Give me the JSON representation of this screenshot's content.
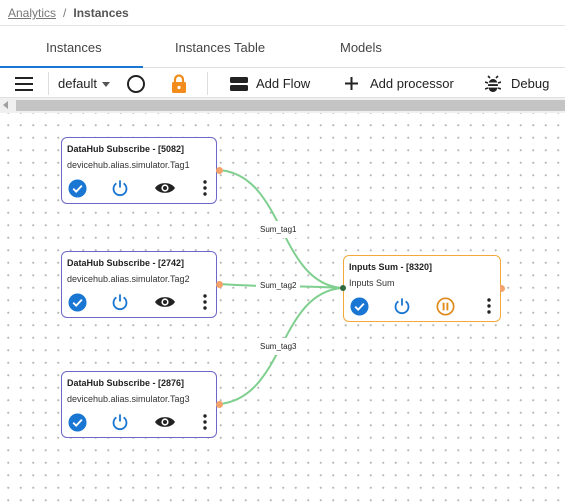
{
  "breadcrumb": {
    "parent": "Analytics",
    "separator": "/",
    "current": "Instances"
  },
  "tabs": [
    {
      "label": "Instances",
      "active": true
    },
    {
      "label": "Instances Table",
      "active": false
    },
    {
      "label": "Models",
      "active": false
    }
  ],
  "toolbar": {
    "menu_icon": "hamburger-menu-icon",
    "flow_select_value": "default",
    "status_icon": "circle-outline-icon",
    "lock_icon": "lock-icon",
    "add_flow_label": "Add Flow",
    "add_processor_label": "Add processor",
    "debug_label": "Debug"
  },
  "nodes": [
    {
      "title": "DataHub Subscribe - [5082]",
      "subtitle": "devicehub.alias.simulator.Tag1",
      "type": "source"
    },
    {
      "title": "DataHub Subscribe - [2742]",
      "subtitle": "devicehub.alias.simulator.Tag2",
      "type": "source"
    },
    {
      "title": "DataHub Subscribe - [2876]",
      "subtitle": "devicehub.alias.simulator.Tag3",
      "type": "source"
    },
    {
      "title": "Inputs Sum - [8320]",
      "subtitle": "Inputs Sum",
      "type": "processor"
    }
  ],
  "edges": [
    {
      "from": "DataHub Subscribe - [5082]",
      "to": "Inputs Sum - [8320]",
      "label": "Sum_tag1"
    },
    {
      "from": "DataHub Subscribe - [2742]",
      "to": "Inputs Sum - [8320]",
      "label": "Sum_tag2"
    },
    {
      "from": "DataHub Subscribe - [2876]",
      "to": "Inputs Sum - [8320]",
      "label": "Sum_tag3"
    }
  ],
  "colors": {
    "accent": "#1976d2",
    "source_border": "#6b68c9",
    "processor_border": "#f2a93a",
    "link": "#7fcf8f",
    "port": "#f4a36b",
    "lock": "#f28c1c"
  }
}
